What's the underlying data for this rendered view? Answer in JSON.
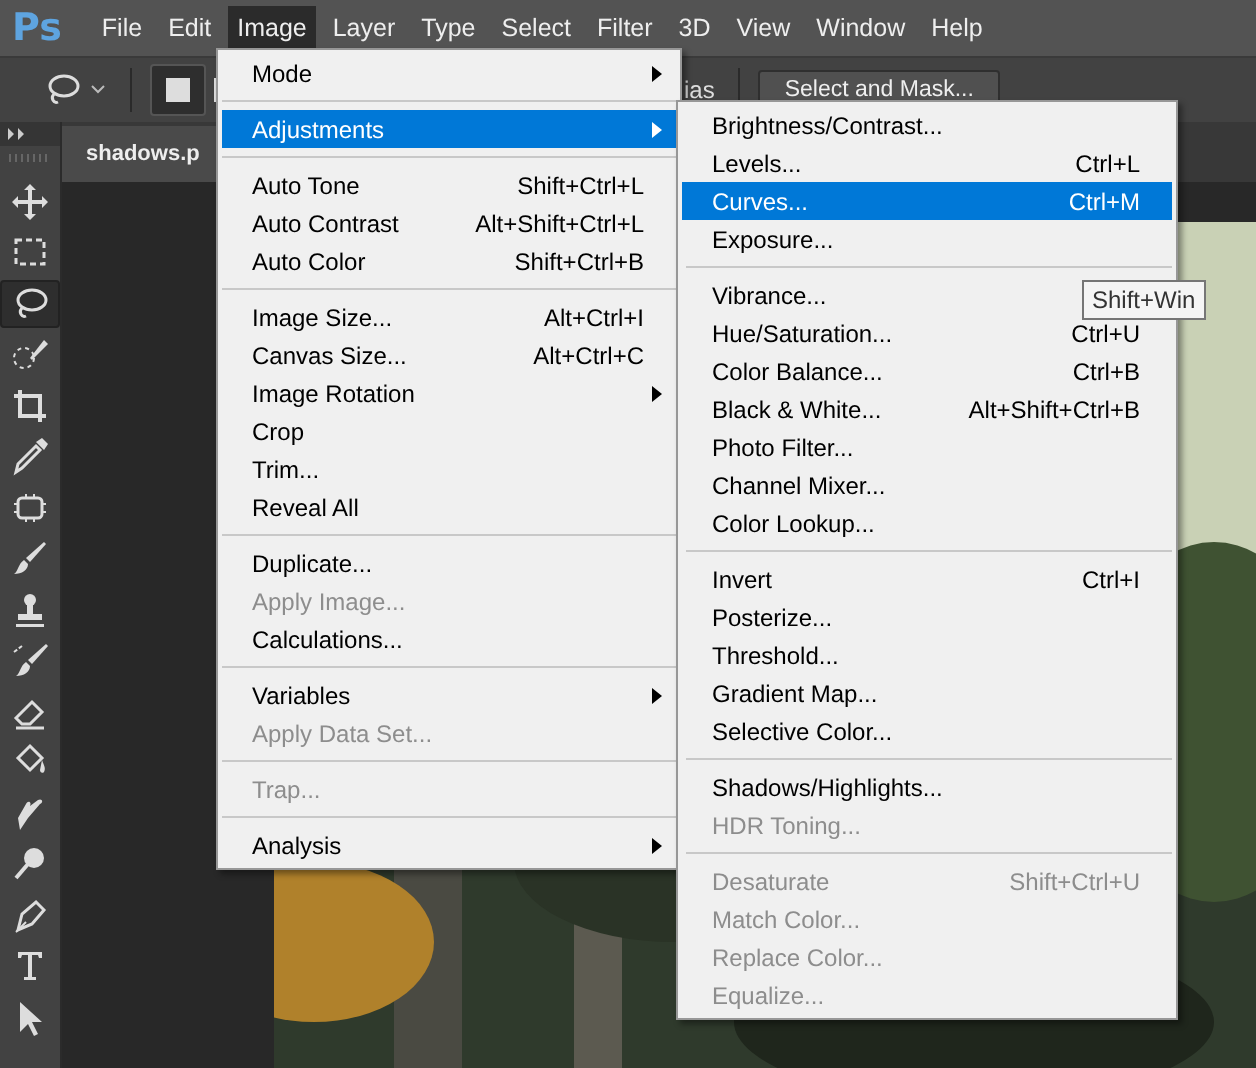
{
  "app_logo": "Ps",
  "menu_bar": [
    {
      "label": "File",
      "selected": false
    },
    {
      "label": "Edit",
      "selected": false
    },
    {
      "label": "Image",
      "selected": true
    },
    {
      "label": "Layer",
      "selected": false
    },
    {
      "label": "Type",
      "selected": false
    },
    {
      "label": "Select",
      "selected": false
    },
    {
      "label": "Filter",
      "selected": false
    },
    {
      "label": "3D",
      "selected": false
    },
    {
      "label": "View",
      "selected": false
    },
    {
      "label": "Window",
      "selected": false
    },
    {
      "label": "Help",
      "selected": false
    }
  ],
  "options_bar": {
    "partial_label": "ias",
    "button": "Select and Mask..."
  },
  "tools": [
    {
      "kind": "move",
      "selected": false
    },
    {
      "kind": "marquee",
      "selected": false
    },
    {
      "kind": "lasso",
      "selected": true
    },
    {
      "kind": "quick-select",
      "selected": false
    },
    {
      "kind": "crop",
      "selected": false
    },
    {
      "kind": "eyedropper",
      "selected": false
    },
    {
      "kind": "frame",
      "selected": false
    },
    {
      "kind": "brush",
      "selected": false
    },
    {
      "kind": "stamp",
      "selected": false
    },
    {
      "kind": "history-brush",
      "selected": false
    },
    {
      "kind": "eraser",
      "selected": false
    },
    {
      "kind": "bucket",
      "selected": false
    },
    {
      "kind": "smudge",
      "selected": false
    },
    {
      "kind": "dodge",
      "selected": false
    },
    {
      "kind": "pen",
      "selected": false
    },
    {
      "kind": "type",
      "selected": false
    },
    {
      "kind": "arrow",
      "selected": false
    }
  ],
  "document_tab": "shadows.p",
  "image_menu": [
    {
      "kind": "item",
      "label": "Mode",
      "submenu": true,
      "disabled": false,
      "selected": false
    },
    {
      "kind": "separator"
    },
    {
      "kind": "item",
      "label": "Adjustments",
      "submenu": true,
      "disabled": false,
      "selected": true
    },
    {
      "kind": "separator"
    },
    {
      "kind": "item",
      "label": "Auto Tone",
      "shortcut": "Shift+Ctrl+L",
      "disabled": false,
      "selected": false
    },
    {
      "kind": "item",
      "label": "Auto Contrast",
      "shortcut": "Alt+Shift+Ctrl+L",
      "disabled": false,
      "selected": false
    },
    {
      "kind": "item",
      "label": "Auto Color",
      "shortcut": "Shift+Ctrl+B",
      "disabled": false,
      "selected": false
    },
    {
      "kind": "separator"
    },
    {
      "kind": "item",
      "label": "Image Size...",
      "shortcut": "Alt+Ctrl+I",
      "disabled": false,
      "selected": false
    },
    {
      "kind": "item",
      "label": "Canvas Size...",
      "shortcut": "Alt+Ctrl+C",
      "disabled": false,
      "selected": false
    },
    {
      "kind": "item",
      "label": "Image Rotation",
      "submenu": true,
      "disabled": false,
      "selected": false
    },
    {
      "kind": "item",
      "label": "Crop",
      "disabled": false,
      "selected": false
    },
    {
      "kind": "item",
      "label": "Trim...",
      "disabled": false,
      "selected": false
    },
    {
      "kind": "item",
      "label": "Reveal All",
      "disabled": false,
      "selected": false
    },
    {
      "kind": "separator"
    },
    {
      "kind": "item",
      "label": "Duplicate...",
      "disabled": false,
      "selected": false
    },
    {
      "kind": "item",
      "label": "Apply Image...",
      "disabled": true,
      "selected": false
    },
    {
      "kind": "item",
      "label": "Calculations...",
      "disabled": false,
      "selected": false
    },
    {
      "kind": "separator"
    },
    {
      "kind": "item",
      "label": "Variables",
      "submenu": true,
      "disabled": false,
      "selected": false
    },
    {
      "kind": "item",
      "label": "Apply Data Set...",
      "disabled": true,
      "selected": false
    },
    {
      "kind": "separator"
    },
    {
      "kind": "item",
      "label": "Trap...",
      "disabled": true,
      "selected": false
    },
    {
      "kind": "separator"
    },
    {
      "kind": "item",
      "label": "Analysis",
      "submenu": true,
      "disabled": false,
      "selected": false
    }
  ],
  "adjustments_menu": [
    {
      "kind": "item",
      "label": "Brightness/Contrast...",
      "disabled": false,
      "selected": false
    },
    {
      "kind": "item",
      "label": "Levels...",
      "shortcut": "Ctrl+L",
      "disabled": false,
      "selected": false
    },
    {
      "kind": "item",
      "label": "Curves...",
      "shortcut": "Ctrl+M",
      "disabled": false,
      "selected": true
    },
    {
      "kind": "item",
      "label": "Exposure...",
      "disabled": false,
      "selected": false
    },
    {
      "kind": "separator"
    },
    {
      "kind": "item",
      "label": "Vibrance...",
      "disabled": false,
      "selected": false
    },
    {
      "kind": "item",
      "label": "Hue/Saturation...",
      "shortcut": "Ctrl+U",
      "disabled": false,
      "selected": false
    },
    {
      "kind": "item",
      "label": "Color Balance...",
      "shortcut": "Ctrl+B",
      "disabled": false,
      "selected": false
    },
    {
      "kind": "item",
      "label": "Black & White...",
      "shortcut": "Alt+Shift+Ctrl+B",
      "disabled": false,
      "selected": false
    },
    {
      "kind": "item",
      "label": "Photo Filter...",
      "disabled": false,
      "selected": false
    },
    {
      "kind": "item",
      "label": "Channel Mixer...",
      "disabled": false,
      "selected": false
    },
    {
      "kind": "item",
      "label": "Color Lookup...",
      "disabled": false,
      "selected": false
    },
    {
      "kind": "separator"
    },
    {
      "kind": "item",
      "label": "Invert",
      "shortcut": "Ctrl+I",
      "disabled": false,
      "selected": false
    },
    {
      "kind": "item",
      "label": "Posterize...",
      "disabled": false,
      "selected": false
    },
    {
      "kind": "item",
      "label": "Threshold...",
      "disabled": false,
      "selected": false
    },
    {
      "kind": "item",
      "label": "Gradient Map...",
      "disabled": false,
      "selected": false
    },
    {
      "kind": "item",
      "label": "Selective Color...",
      "disabled": false,
      "selected": false
    },
    {
      "kind": "separator"
    },
    {
      "kind": "item",
      "label": "Shadows/Highlights...",
      "disabled": false,
      "selected": false
    },
    {
      "kind": "item",
      "label": "HDR Toning...",
      "disabled": true,
      "selected": false
    },
    {
      "kind": "separator"
    },
    {
      "kind": "item",
      "label": "Desaturate",
      "shortcut": "Shift+Ctrl+U",
      "disabled": true,
      "selected": false
    },
    {
      "kind": "item",
      "label": "Match Color...",
      "disabled": true,
      "selected": false
    },
    {
      "kind": "item",
      "label": "Replace Color...",
      "disabled": true,
      "selected": false
    },
    {
      "kind": "item",
      "label": "Equalize...",
      "disabled": true,
      "selected": false
    }
  ],
  "tooltip": "Shift+Win"
}
